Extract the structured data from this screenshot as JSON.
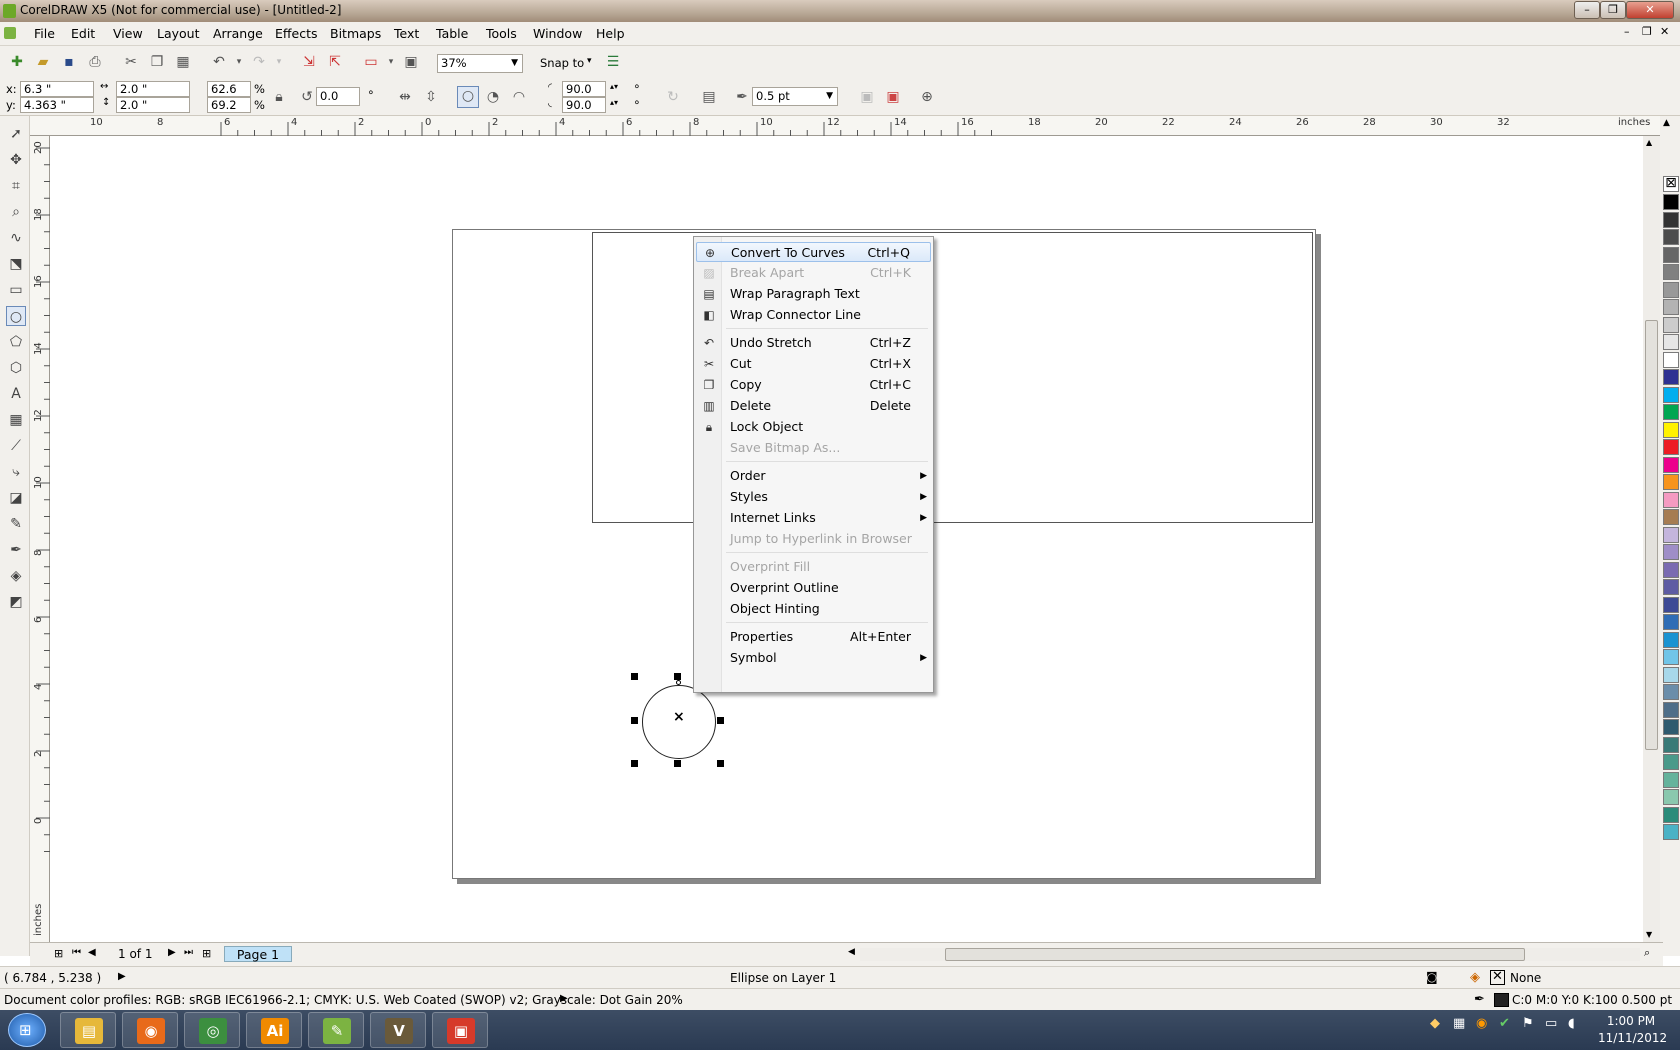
{
  "window": {
    "title": "CorelDRAW X5 (Not for commercial use) - [Untitled-2]",
    "controls": [
      "–",
      "❐",
      "✕"
    ],
    "doc_controls": [
      "–",
      "❐",
      "✕"
    ]
  },
  "menubar": [
    "File",
    "Edit",
    "View",
    "Layout",
    "Arrange",
    "Effects",
    "Bitmaps",
    "Text",
    "Table",
    "Tools",
    "Window",
    "Help"
  ],
  "standard": {
    "zoom": "37%",
    "snap_label": "Snap to"
  },
  "property_bar": {
    "x": "6.3 \"",
    "y": "4.363 \"",
    "width": "2.0 \"",
    "height": "2.0 \"",
    "scale_x": "62.6",
    "scale_y": "69.2",
    "pct": "%",
    "angle": "0.0",
    "degree": "°",
    "start_angle": "90.0",
    "end_angle": "90.0",
    "outline": "0.5 pt",
    "x_label": "x:",
    "y_label": "y:"
  },
  "ruler": {
    "h_labels": [
      "10",
      "8",
      "6",
      "4",
      "2",
      "0",
      "2",
      "4",
      "6",
      "8",
      "10",
      "12",
      "14",
      "16",
      "18",
      "20",
      "22",
      "24",
      "26",
      "28",
      "30",
      "32"
    ],
    "h_unit": "inches",
    "v_labels": [
      "20",
      "18",
      "16",
      "14",
      "12",
      "10",
      "8",
      "6",
      "4",
      "2",
      "0"
    ],
    "v_unit": "inches"
  },
  "context_menu": [
    {
      "label": "Convert To Curves",
      "shortcut": "Ctrl+Q",
      "icon": "convert-curves-icon",
      "state": "highlight"
    },
    {
      "label": "Break Apart",
      "shortcut": "Ctrl+K",
      "icon": "break-apart-icon",
      "state": "disabled"
    },
    {
      "label": "Wrap Paragraph Text",
      "shortcut": "",
      "icon": "wrap-text-icon",
      "state": "normal"
    },
    {
      "label": "Wrap Connector Line",
      "shortcut": "",
      "icon": "wrap-connector-icon",
      "state": "normal"
    },
    {
      "label": "Undo Stretch",
      "shortcut": "Ctrl+Z",
      "icon": "undo-icon",
      "state": "normal"
    },
    {
      "label": "Cut",
      "shortcut": "Ctrl+X",
      "icon": "scissors-icon",
      "state": "normal"
    },
    {
      "label": "Copy",
      "shortcut": "Ctrl+C",
      "icon": "copy-icon",
      "state": "normal"
    },
    {
      "label": "Delete",
      "shortcut": "Delete",
      "icon": "trash-icon",
      "state": "normal"
    },
    {
      "label": "Lock Object",
      "shortcut": "",
      "icon": "lock-icon",
      "state": "normal"
    },
    {
      "label": "Save Bitmap As...",
      "shortcut": "",
      "icon": "",
      "state": "disabled"
    },
    {
      "label": "Order",
      "shortcut": "",
      "icon": "",
      "state": "submenu"
    },
    {
      "label": "Styles",
      "shortcut": "",
      "icon": "",
      "state": "submenu"
    },
    {
      "label": "Internet Links",
      "shortcut": "",
      "icon": "",
      "state": "submenu"
    },
    {
      "label": "Jump to Hyperlink in Browser",
      "shortcut": "",
      "icon": "",
      "state": "disabled"
    },
    {
      "label": "Overprint Fill",
      "shortcut": "",
      "icon": "",
      "state": "disabled"
    },
    {
      "label": "Overprint Outline",
      "shortcut": "",
      "icon": "",
      "state": "normal"
    },
    {
      "label": "Object Hinting",
      "shortcut": "",
      "icon": "",
      "state": "normal"
    },
    {
      "label": "Properties",
      "shortcut": "Alt+Enter",
      "icon": "",
      "state": "normal"
    },
    {
      "label": "Symbol",
      "shortcut": "",
      "icon": "",
      "state": "submenu"
    }
  ],
  "page_nav": {
    "count": "1 of 1",
    "tab": "Page 1"
  },
  "status": {
    "coords": "( 6.784 , 5.238 )",
    "object": "Ellipse on Layer 1",
    "fill": "None",
    "outline": "C:0 M:0 Y:0 K:100  0.500 pt",
    "profiles": "Document color profiles: RGB: sRGB IEC61966-2.1; CMYK: U.S. Web Coated (SWOP) v2; Grayscale: Dot Gain 20%"
  },
  "palette_colors": [
    "#000000",
    "#333333",
    "#4d4d4d",
    "#666666",
    "#808080",
    "#999999",
    "#b3b3b3",
    "#cccccc",
    "#e6e6e6",
    "#ffffff",
    "#2e3192",
    "#00aeef",
    "#00a651",
    "#fff200",
    "#ed1c24",
    "#ec008c",
    "#f7941d",
    "#f49ac1",
    "#a67c52",
    "#c4b5dc",
    "#9f8ec7",
    "#7a6bb1",
    "#5e5ca3",
    "#3d4a95",
    "#2f6db5",
    "#1b93d1",
    "#71c5e8",
    "#a8d8ea",
    "#6b8eaa",
    "#4e6e88",
    "#2e5a6e",
    "#397a77",
    "#4a9a8a",
    "#65b39c",
    "#8ac8ae",
    "#2b8c7a",
    "#4bb2c5"
  ],
  "taskbar": {
    "time": "1:00 PM",
    "date": "11/11/2012",
    "apps": [
      {
        "name": "explorer",
        "glyph": "▤",
        "color": "#e6b83a"
      },
      {
        "name": "firefox",
        "glyph": "◉",
        "color": "#e86a1a"
      },
      {
        "name": "chrome",
        "glyph": "◎",
        "color": "#3c8f3f"
      },
      {
        "name": "illustrator",
        "glyph": "Ai",
        "color": "#f08a00"
      },
      {
        "name": "coreldraw",
        "glyph": "✎",
        "color": "#7cb342"
      },
      {
        "name": "vegas",
        "glyph": "V",
        "color": "#6a5a3a"
      },
      {
        "name": "photo-app",
        "glyph": "▣",
        "color": "#d63a2a"
      }
    ]
  }
}
